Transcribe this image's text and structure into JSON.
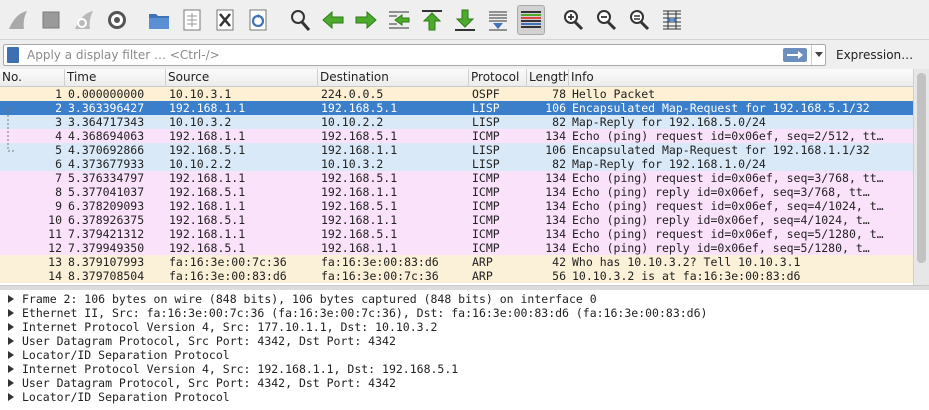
{
  "toolbar": {
    "buttons": [
      "shark-fin-start-icon",
      "stop-square-icon",
      "restart-fin-icon",
      "capture-options-gear-icon",
      "open-folder-icon",
      "save-file-icon",
      "close-file-icon",
      "reload-file-icon",
      "find-magnifier-icon",
      "go-back-arrow-icon",
      "go-forward-arrow-icon",
      "go-to-packet-icon",
      "first-packet-icon",
      "last-packet-icon",
      "auto-scroll-icon",
      "colorize-icon",
      "zoom-in-icon",
      "zoom-out-icon",
      "normal-size-icon",
      "resize-columns-icon"
    ]
  },
  "filter": {
    "placeholder": "Apply a display filter … <Ctrl-/>",
    "value": "",
    "expression_label": "Expression…"
  },
  "packet_list": {
    "headers": [
      "No.",
      "Time",
      "Source",
      "Destination",
      "Protocol",
      "Length",
      "Info"
    ],
    "rows": [
      {
        "no": "1",
        "time": "0.000000000",
        "src": "10.10.3.1",
        "dst": "224.0.0.5",
        "proto": "OSPF",
        "len": "78",
        "info": "Hello Packet",
        "bg": "#fdf0d4"
      },
      {
        "no": "2",
        "time": "3.363396427",
        "src": "192.168.1.1",
        "dst": "192.168.5.1",
        "proto": "LISP",
        "len": "106",
        "info": "Encapsulated Map-Request for 192.168.5.1/32",
        "bg": "#3b7ec9",
        "selected": true
      },
      {
        "no": "3",
        "time": "3.364717343",
        "src": "10.10.3.2",
        "dst": "10.10.2.2",
        "proto": "LISP",
        "len": "82",
        "info": "Map-Reply for 192.168.5.0/24",
        "bg": "#dae9f8"
      },
      {
        "no": "4",
        "time": "4.368694063",
        "src": "192.168.1.1",
        "dst": "192.168.5.1",
        "proto": "ICMP",
        "len": "134",
        "info": "Echo (ping) request  id=0x06ef, seq=2/512, tt…",
        "bg": "#fbe2fb"
      },
      {
        "no": "5",
        "time": "4.370692866",
        "src": "192.168.5.1",
        "dst": "192.168.1.1",
        "proto": "LISP",
        "len": "106",
        "info": "Encapsulated Map-Request for 192.168.1.1/32",
        "bg": "#dae9f8"
      },
      {
        "no": "6",
        "time": "4.373677933",
        "src": "10.10.2.2",
        "dst": "10.10.3.2",
        "proto": "LISP",
        "len": "82",
        "info": "Map-Reply for 192.168.1.0/24",
        "bg": "#dae9f8"
      },
      {
        "no": "7",
        "time": "5.376334797",
        "src": "192.168.1.1",
        "dst": "192.168.5.1",
        "proto": "ICMP",
        "len": "134",
        "info": "Echo (ping) request  id=0x06ef, seq=3/768, tt…",
        "bg": "#fbe2fb"
      },
      {
        "no": "8",
        "time": "5.377041037",
        "src": "192.168.5.1",
        "dst": "192.168.1.1",
        "proto": "ICMP",
        "len": "134",
        "info": "Echo (ping) reply    id=0x06ef, seq=3/768, tt…",
        "bg": "#fbe2fb"
      },
      {
        "no": "9",
        "time": "6.378209093",
        "src": "192.168.1.1",
        "dst": "192.168.5.1",
        "proto": "ICMP",
        "len": "134",
        "info": "Echo (ping) request  id=0x06ef, seq=4/1024, t…",
        "bg": "#fbe2fb"
      },
      {
        "no": "10",
        "time": "6.378926375",
        "src": "192.168.5.1",
        "dst": "192.168.1.1",
        "proto": "ICMP",
        "len": "134",
        "info": "Echo (ping) reply    id=0x06ef, seq=4/1024, t…",
        "bg": "#fbe2fb"
      },
      {
        "no": "11",
        "time": "7.379421312",
        "src": "192.168.1.1",
        "dst": "192.168.5.1",
        "proto": "ICMP",
        "len": "134",
        "info": "Echo (ping) request  id=0x06ef, seq=5/1280, t…",
        "bg": "#fbe2fb"
      },
      {
        "no": "12",
        "time": "7.379949350",
        "src": "192.168.5.1",
        "dst": "192.168.1.1",
        "proto": "ICMP",
        "len": "134",
        "info": "Echo (ping) reply    id=0x06ef, seq=5/1280, t…",
        "bg": "#fbe2fb"
      },
      {
        "no": "13",
        "time": "8.379107993",
        "src": "fa:16:3e:00:7c:36",
        "dst": "fa:16:3e:00:83:d6",
        "proto": "ARP",
        "len": "42",
        "info": "Who has 10.10.3.2? Tell 10.10.3.1",
        "bg": "#fbf0d8"
      },
      {
        "no": "14",
        "time": "8.379708504",
        "src": "fa:16:3e:00:83:d6",
        "dst": "fa:16:3e:00:7c:36",
        "proto": "ARP",
        "len": "56",
        "info": "10.10.3.2 is at fa:16:3e:00:83:d6",
        "bg": "#fbf0d8"
      }
    ]
  },
  "details": [
    "Frame 2: 106 bytes on wire (848 bits), 106 bytes captured (848 bits) on interface 0",
    "Ethernet II, Src: fa:16:3e:00:7c:36 (fa:16:3e:00:7c:36), Dst: fa:16:3e:00:83:d6 (fa:16:3e:00:83:d6)",
    "Internet Protocol Version 4, Src: 177.10.1.1, Dst: 10.10.3.2",
    "User Datagram Protocol, Src Port: 4342, Dst Port: 4342",
    "Locator/ID Separation Protocol",
    "Internet Protocol Version 4, Src: 192.168.1.1, Dst: 192.168.5.1",
    "User Datagram Protocol, Src Port: 4342, Dst Port: 4342",
    "Locator/ID Separation Protocol"
  ],
  "colors": {
    "selected_bg": "#3b7ec9",
    "selected_fg": "#ffffff",
    "accent": "#3f6fb3",
    "arrow_green": "#4caa2c"
  }
}
